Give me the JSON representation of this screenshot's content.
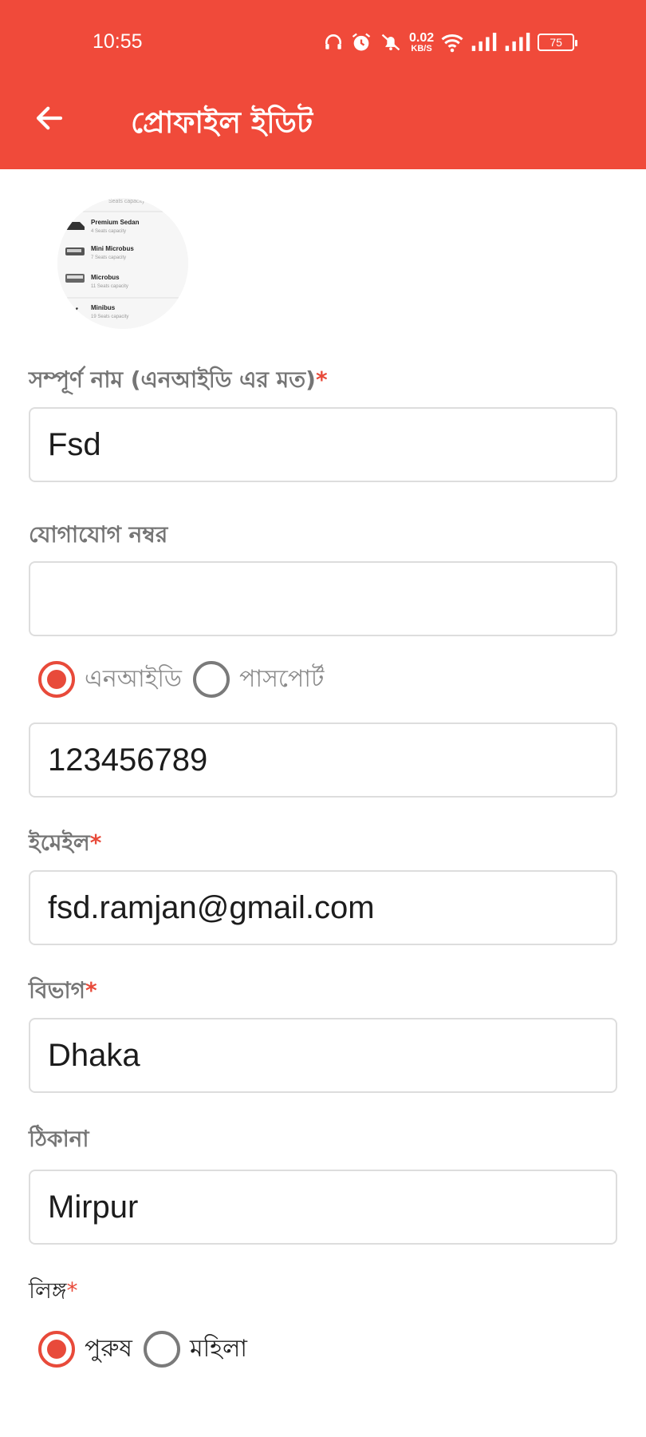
{
  "status_bar": {
    "time": "10:55",
    "net_speed_value": "0.02",
    "net_speed_unit": "KB/S",
    "battery": "75",
    "icons": [
      "headphones-icon",
      "alarm-icon",
      "mute-icon",
      "wifi-icon",
      "signal-icon",
      "signal-icon",
      "battery-icon"
    ]
  },
  "app_bar": {
    "title": "প্রোফাইল ইডিট",
    "back_icon": "arrow-left-icon",
    "color": "#f04a3a"
  },
  "avatar": {
    "items": [
      {
        "name": "Premium Sedan",
        "sub": "4 Seats capacity"
      },
      {
        "name": "Mini Microbus",
        "sub": "7 Seats capacity"
      },
      {
        "name": "Microbus",
        "sub": "11 Seats capacity"
      },
      {
        "name": "Minibus",
        "sub": "19 Seats capacity"
      }
    ],
    "top_text": "Seats capacity"
  },
  "form": {
    "full_name": {
      "label": "সম্পূর্ণ নাম (এনআইডি এর মত)",
      "required": "*",
      "value": "Fsd"
    },
    "contact": {
      "label": "যোগাযোগ নম্বর",
      "value": ""
    },
    "id_type": {
      "options": [
        "এনআইডি",
        "পাসপোর্ট"
      ],
      "selected": "এনআইডি"
    },
    "id_number": {
      "value": "123456789"
    },
    "email": {
      "label": "ইমেইল",
      "required": "*",
      "value": "fsd.ramjan@gmail.com"
    },
    "division": {
      "label": "বিভাগ",
      "required": "*",
      "value": "Dhaka"
    },
    "address": {
      "label": "ঠিকানা",
      "value": "Mirpur"
    },
    "gender": {
      "label": "লিঙ্গ",
      "required": "*",
      "options": [
        "পুরুষ",
        "মহিলা"
      ],
      "selected": "পুরুষ"
    }
  },
  "colors": {
    "accent": "#e84a3a",
    "label_gray": "#757575",
    "border": "#dddddd"
  }
}
